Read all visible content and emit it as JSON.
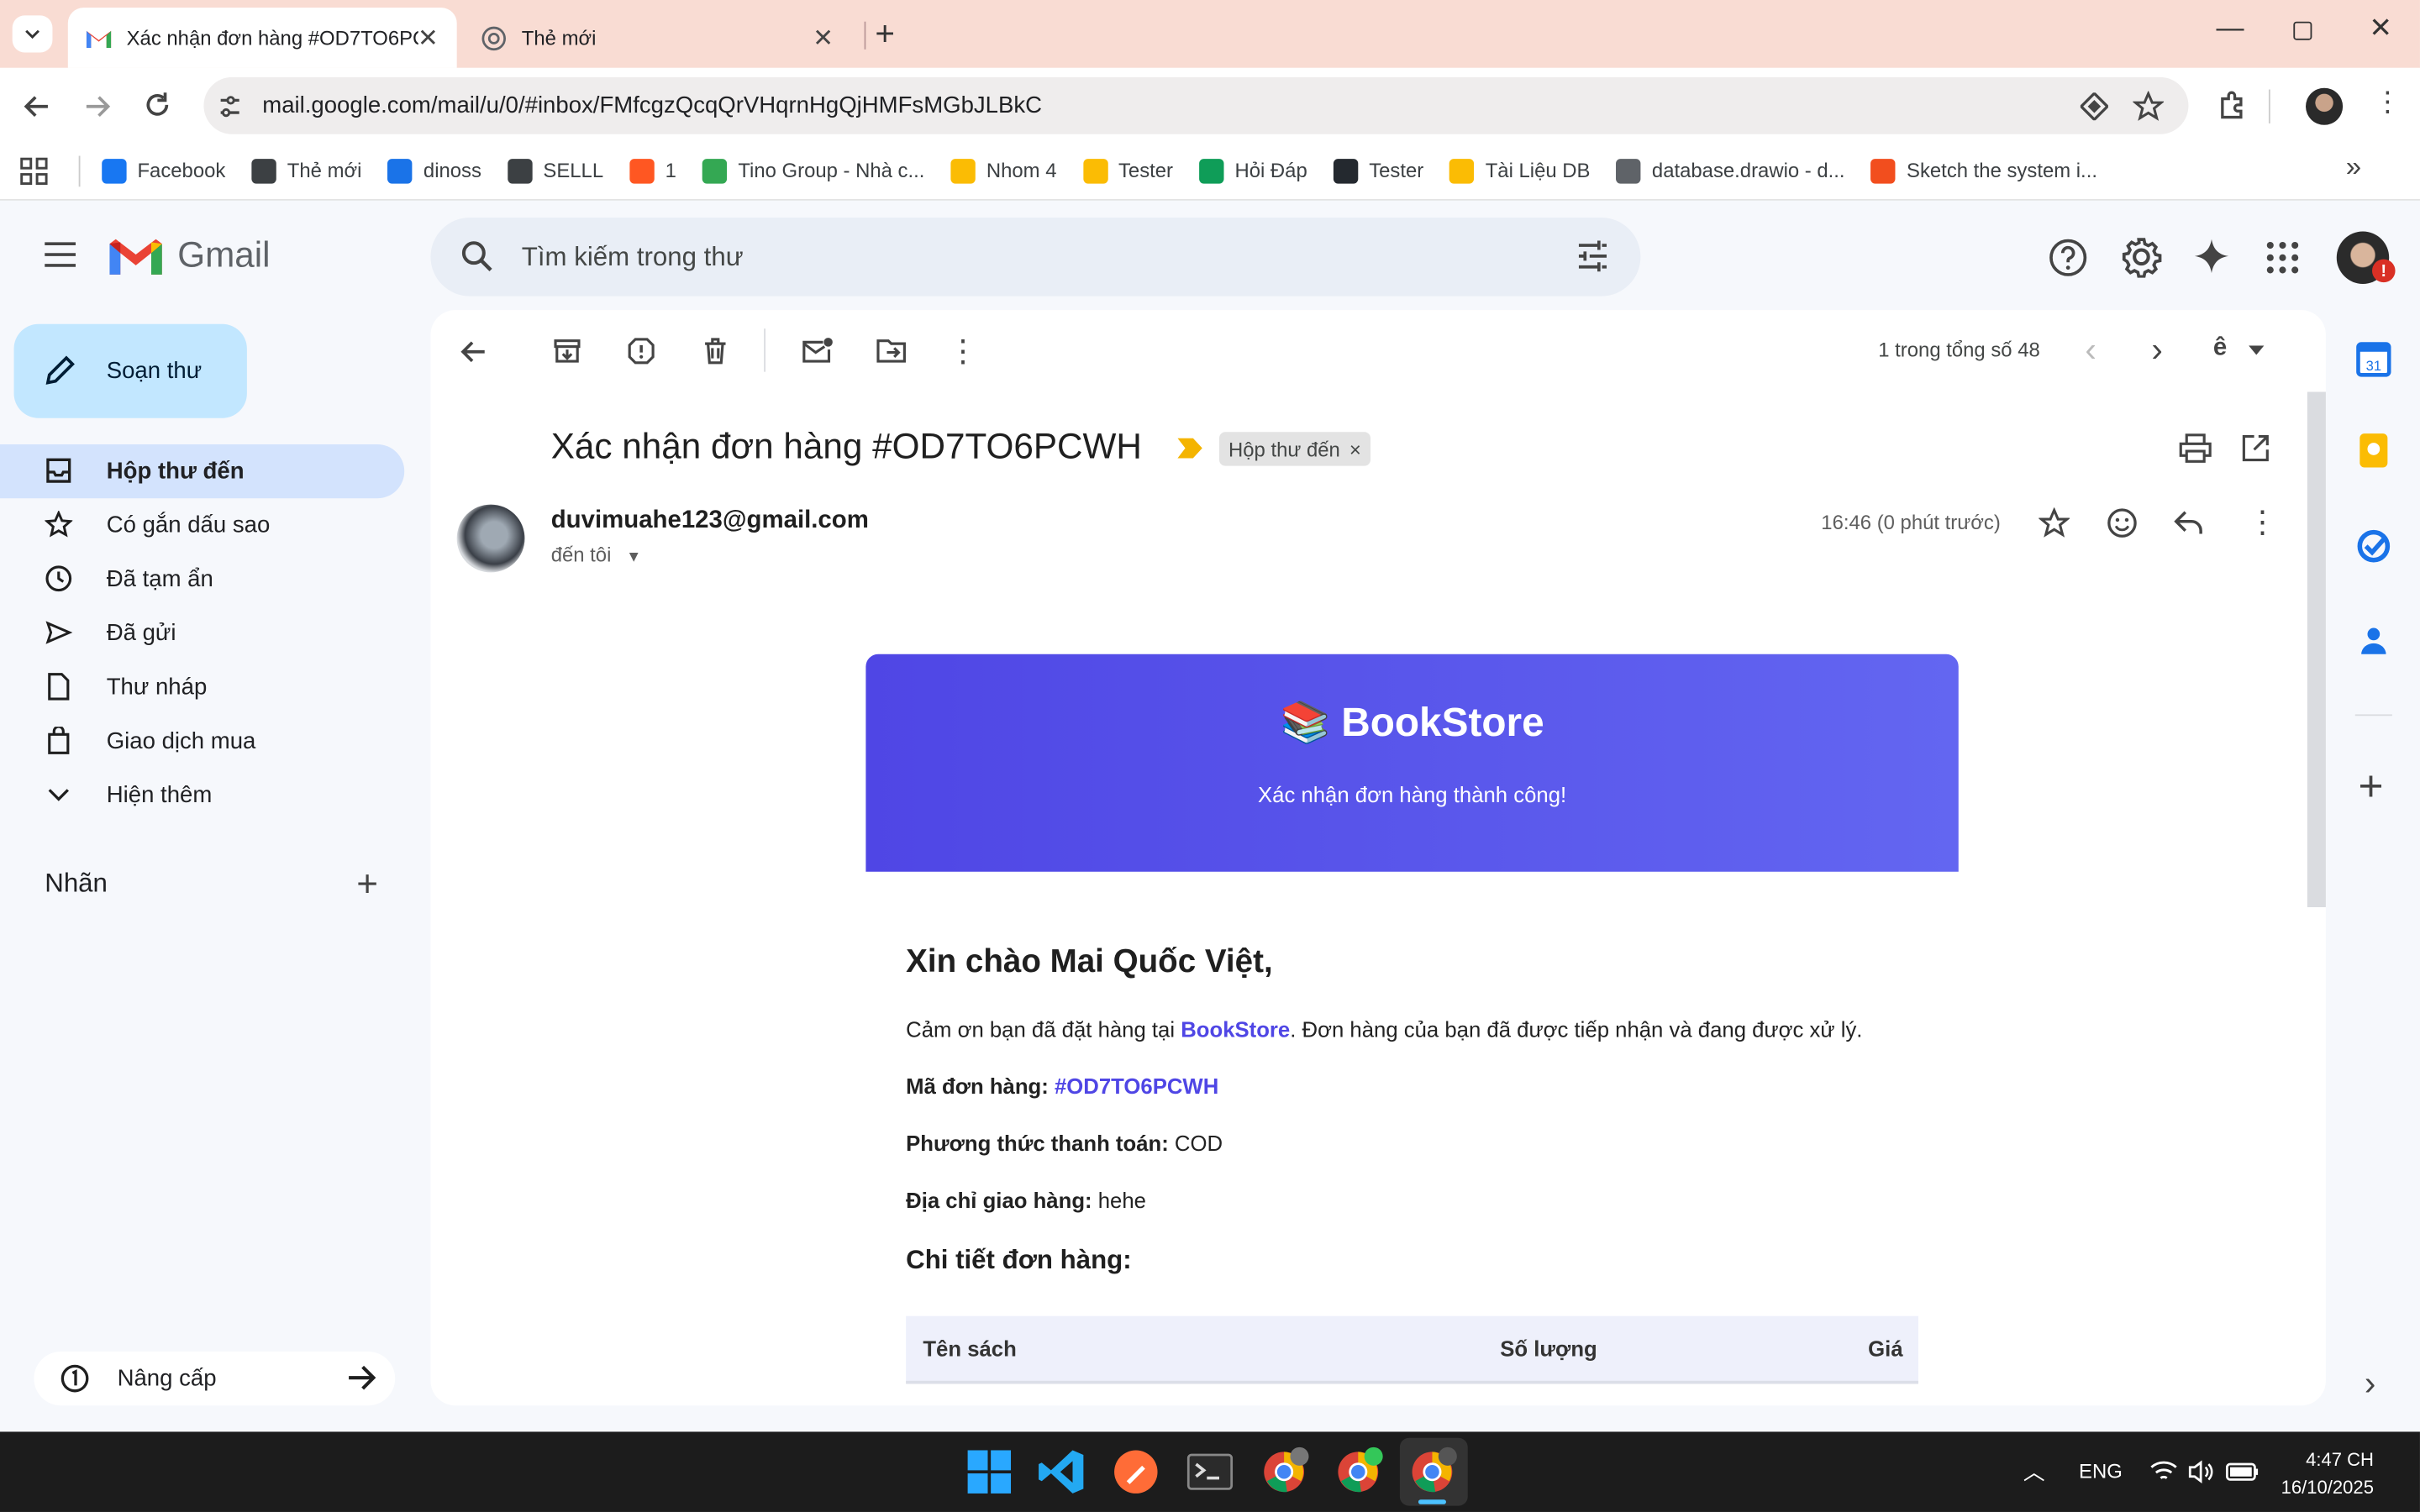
{
  "browser": {
    "tabs": [
      {
        "title": "Xác nhận đơn hàng #OD7TO6PCWH"
      },
      {
        "title": "Thẻ mới"
      }
    ],
    "url": "mail.google.com/mail/u/0/#inbox/FMfcgzQcqQrVHqrnHgQjHMFsMGbJLBkC",
    "bookmarks": [
      {
        "label": "Facebook",
        "color": "#1877f2"
      },
      {
        "label": "Thẻ mới",
        "color": "#3c4043"
      },
      {
        "label": "dinoss",
        "color": "#1a73e8"
      },
      {
        "label": "SELLL",
        "color": "#3c4043"
      },
      {
        "label": "1",
        "color": "#ff5722"
      },
      {
        "label": "Tino Group - Nhà c...",
        "color": "#34a853"
      },
      {
        "label": "Nhom 4",
        "color": "#fbbc04"
      },
      {
        "label": "Tester",
        "color": "#fbbc04"
      },
      {
        "label": "Hỏi Đáp",
        "color": "#0f9d58"
      },
      {
        "label": "Tester",
        "color": "#24292f"
      },
      {
        "label": "Tài Liệu DB",
        "color": "#fbbc04"
      },
      {
        "label": "database.drawio - d...",
        "color": "#5f6368"
      },
      {
        "label": "Sketch the system i...",
        "color": "#f24e1e"
      }
    ]
  },
  "gmail": {
    "product": "Gmail",
    "search_placeholder": "Tìm kiếm trong thư",
    "compose_label": "Soạn thư",
    "nav": [
      {
        "label": "Hộp thư đến",
        "icon": "inbox-icon"
      },
      {
        "label": "Có gắn dấu sao",
        "icon": "star-icon"
      },
      {
        "label": "Đã tạm ẩn",
        "icon": "clock-icon"
      },
      {
        "label": "Đã gửi",
        "icon": "send-icon"
      },
      {
        "label": "Thư nháp",
        "icon": "draft-icon"
      },
      {
        "label": "Giao dịch mua",
        "icon": "bag-icon"
      },
      {
        "label": "Hiện thêm",
        "icon": "chevron-down-icon"
      }
    ],
    "labels_heading": "Nhãn",
    "upgrade_label": "Nâng cấp",
    "paging": "1 trong tổng số 48"
  },
  "email": {
    "subject": "Xác nhận đơn hàng #OD7TO6PCWH",
    "chip": "Hộp thư đến",
    "sender": "duvimuahe123@gmail.com",
    "to": "đến tôi",
    "time": "16:46 (0 phút trước)",
    "body": {
      "brand_emoji": "📚",
      "brand": "BookStore",
      "banner_sub": "Xác nhận đơn hàng thành công!",
      "greeting": "Xin chào Mai Quốc Việt,",
      "thanks_pre": "Cảm ơn bạn đã đặt hàng tại ",
      "thanks_brand": "BookStore",
      "thanks_post": ". Đơn hàng của bạn đã được tiếp nhận và đang được xử lý.",
      "order_label": "Mã đơn hàng:",
      "order_code": "#OD7TO6PCWH",
      "payment_label": "Phương thức thanh toán:",
      "payment_value": "COD",
      "address_label": "Địa chỉ giao hàng:",
      "address_value": "hehe",
      "details_heading": "Chi tiết đơn hàng:",
      "table_headers": [
        "Tên sách",
        "Số lượng",
        "Giá"
      ]
    }
  },
  "taskbar": {
    "lang": "ENG",
    "time": "4:47 CH",
    "date": "16/10/2025"
  },
  "colors": {
    "accent": "#4f46e5",
    "nav_active": "#d3e3fd",
    "compose": "#c2e7ff"
  }
}
